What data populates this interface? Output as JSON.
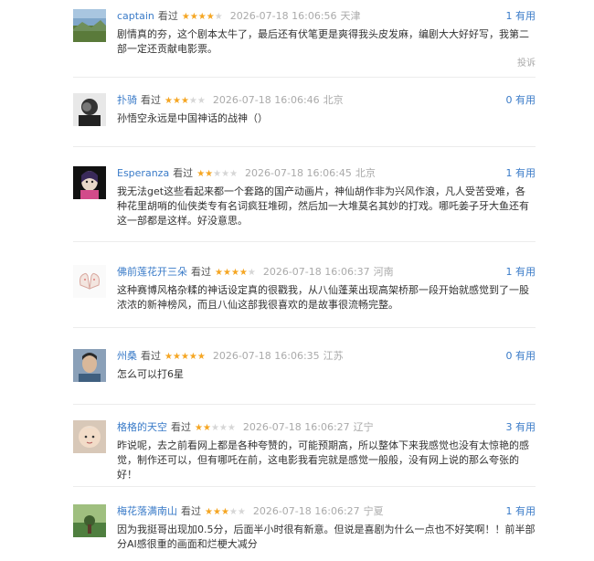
{
  "reviews": [
    {
      "user": "captain",
      "seen": "看过",
      "rating": 4,
      "date": "2026-07-18 16:06:56",
      "location": "天津",
      "useful": "1 有用",
      "text": "剧情真的夯，这个剧本太牛了，最后还有伏笔更是爽得我头皮发麻，编剧大大好好写，我第二部一定还贡献电影票。",
      "report": "投诉"
    },
    {
      "user": "扑骑",
      "seen": "看过",
      "rating": 3,
      "date": "2026-07-18 16:06:46",
      "location": "北京",
      "useful": "0 有用",
      "text": "孙悟空永远是中国神话的战神（）"
    },
    {
      "user": "Esperanza",
      "seen": "看过",
      "rating": 2,
      "date": "2026-07-18 16:06:45",
      "location": "北京",
      "useful": "1 有用",
      "text": "我无法get这些看起来都一个套路的国产动画片，神仙胡作非为兴风作浪，凡人受苦受难，各种花里胡哨的仙侠类专有名词疯狂堆砌，然后加一大堆莫名其妙的打戏。哪吒姜子牙大鱼还有这一部都是这样。好没意思。"
    },
    {
      "user": "佛前莲花开三朵",
      "seen": "看过",
      "rating": 4,
      "date": "2026-07-18 16:06:37",
      "location": "河南",
      "useful": "1 有用",
      "text": "这种赛博风格杂糅的神话设定真的很戳我，从八仙蓬莱出现高架桥那一段开始就感觉到了一股浓浓的新神榜风，而且八仙这部我很喜欢的是故事很流畅完整。"
    },
    {
      "user": "州桑",
      "seen": "看过",
      "rating": 5,
      "date": "2026-07-18 16:06:35",
      "location": "江苏",
      "useful": "0 有用",
      "text": "怎么可以打6星"
    },
    {
      "user": "格格的天空",
      "seen": "看过",
      "rating": 2,
      "date": "2026-07-18 16:06:27",
      "location": "辽宁",
      "useful": "3 有用",
      "text": "昨说呢，去之前看网上都是各种夸赞的，可能预期高，所以整体下来我感觉也没有太惊艳的感觉，制作还可以，但有哪吒在前，这电影我看完就是感觉一般般，没有网上说的那么夸张的好！"
    },
    {
      "user": "梅花落满南山",
      "seen": "看过",
      "rating": 3,
      "date": "2026-07-18 16:06:27",
      "location": "宁夏",
      "useful": "1 有用",
      "text": "因为我挺哥出现加0.5分，后面半小时很有新意。但说是喜剧为什么一点也不好笑啊！！前半部分AI感很重的画面和烂梗大减分"
    }
  ],
  "star_glyph": "★",
  "colors": {
    "link": "#3a7bc8",
    "star": "#f5a623",
    "star_off": "#d6d6d6",
    "muted": "#aaaaaa"
  }
}
